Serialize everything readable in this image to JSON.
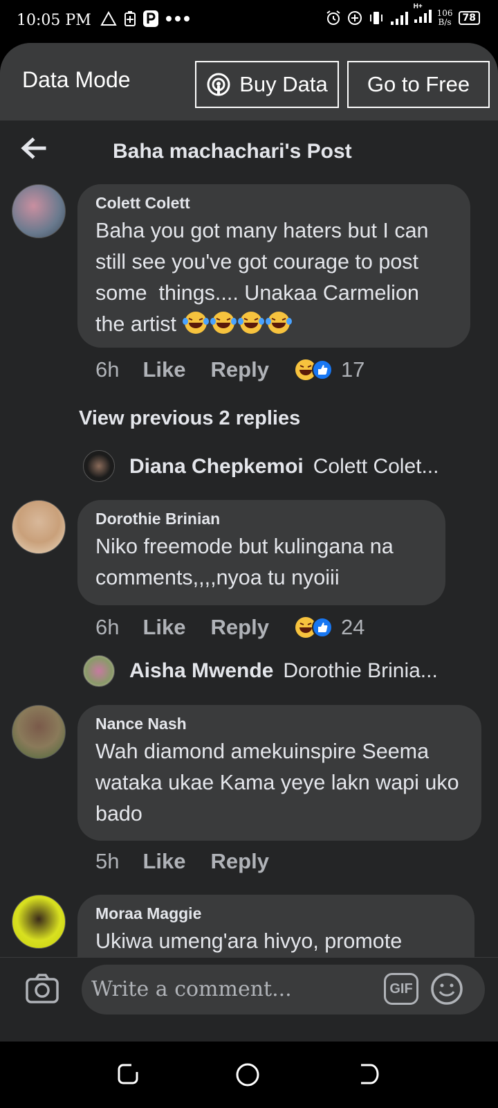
{
  "status_bar": {
    "time": "10:05 PM",
    "speed_value": "106",
    "speed_unit": "B/s",
    "battery": "78",
    "network": "H+"
  },
  "data_bar": {
    "label": "Data Mode",
    "buy_label": "Buy Data",
    "free_label": "Go to Free"
  },
  "header": {
    "title": "Baha machachari's Post"
  },
  "comments": [
    {
      "name": "Colett Colett",
      "text": "Baha you got many haters but I can still see you've got courage to post some  things.... Unakaa Carmelion the artist",
      "time": "6h",
      "like": "Like",
      "reply": "Reply",
      "count": "17"
    },
    {
      "name": "Dorothie Brinian",
      "text": "Niko freemode but kulingana na comments,,,,nyoa tu nyoiii",
      "time": "6h",
      "like": "Like",
      "reply": "Reply",
      "count": "24"
    },
    {
      "name": "Nance Nash",
      "text": "Wah diamond amekuinspire Seema wataka ukae Kama yeye lakn wapi uko bado",
      "time": "5h",
      "like": "Like",
      "reply": "Reply"
    },
    {
      "name": "Moraa Maggie",
      "text": "Ukiwa umeng'ara hivyo, promote"
    }
  ],
  "view_previous": "View previous 2 replies",
  "replies": [
    {
      "name": "Diana Chepkemoi",
      "preview": "Colett Colet..."
    },
    {
      "name": "Aisha Mwende",
      "preview": "Dorothie Brinia..."
    }
  ],
  "composer": {
    "placeholder": "Write a comment...",
    "gif_label": "GIF"
  },
  "colors": {
    "background": "#242526",
    "bubble": "#3a3b3c",
    "like_blue": "#1877f2",
    "haha_yellow": "#f7c33e"
  }
}
